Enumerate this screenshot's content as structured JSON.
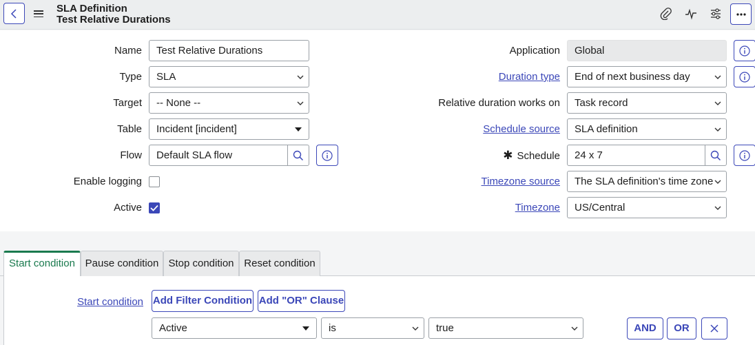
{
  "header": {
    "record_type": "SLA Definition",
    "record_name": "Test Relative Durations"
  },
  "form": {
    "name_label": "Name",
    "name_value": "Test Relative Durations",
    "type_label": "Type",
    "type_value": "SLA",
    "target_label": "Target",
    "target_value": "-- None --",
    "table_label": "Table",
    "table_value": "Incident [incident]",
    "flow_label": "Flow",
    "flow_value": "Default SLA flow",
    "enable_logging_label": "Enable logging",
    "enable_logging_checked": false,
    "active_label": "Active",
    "active_checked": true,
    "application_label": "Application",
    "application_value": "Global",
    "duration_type_label": "Duration type",
    "duration_type_value": "End of next business day",
    "relative_label": "Relative duration works on",
    "relative_value": "Task record",
    "schedule_source_label": "Schedule source",
    "schedule_source_value": "SLA definition",
    "schedule_required": "✱",
    "schedule_label": "Schedule",
    "schedule_value": "24 x 7",
    "timezone_source_label": "Timezone source",
    "timezone_source_value": "The SLA definition's time zone",
    "timezone_label": "Timezone",
    "timezone_value": "US/Central"
  },
  "tabs": [
    {
      "label": "Start condition",
      "active": true
    },
    {
      "label": "Pause condition",
      "active": false
    },
    {
      "label": "Stop condition",
      "active": false
    },
    {
      "label": "Reset condition",
      "active": false
    }
  ],
  "condition": {
    "start_condition_link": "Start condition",
    "add_filter_label": "Add Filter Condition",
    "add_or_label": "Add \"OR\" Clause",
    "field_value": "Active",
    "operator_value": "is",
    "value_value": "true",
    "and_label": "AND",
    "or_label": "OR"
  },
  "colors": {
    "accent": "#3b47b8",
    "active_tab": "#1a7a4e"
  }
}
